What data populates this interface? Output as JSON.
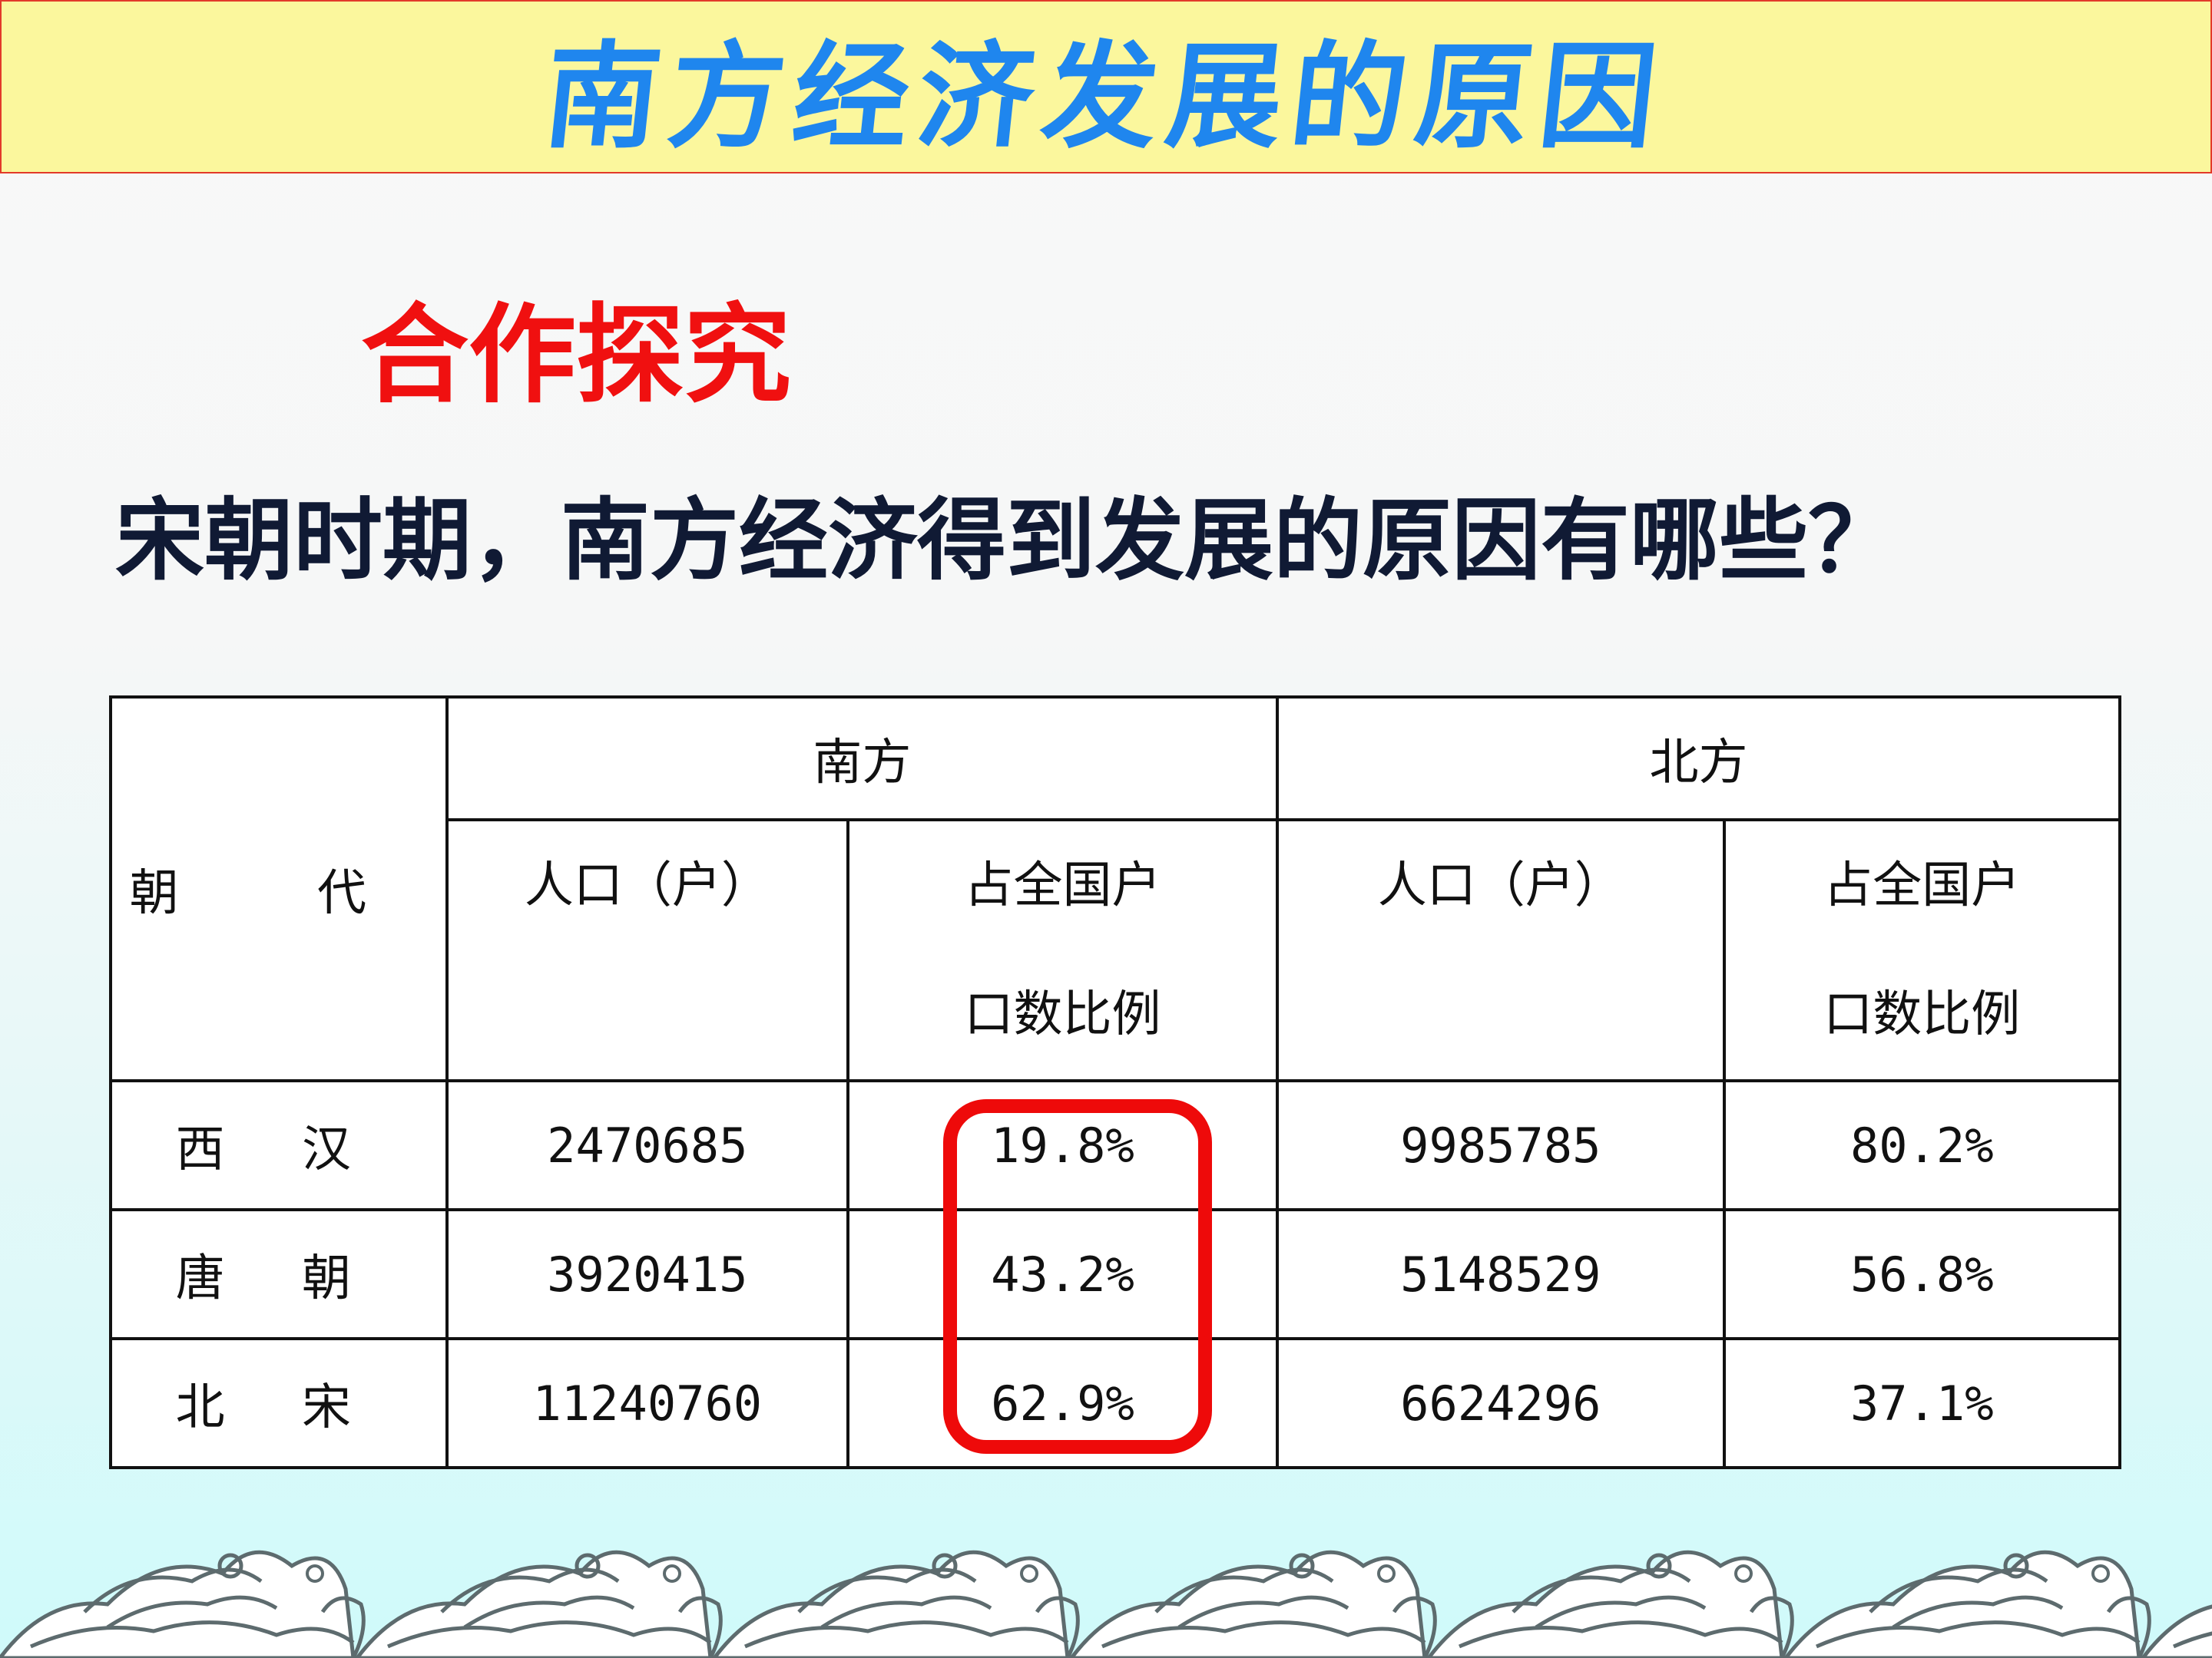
{
  "slide": {
    "title": "南方经济发展的原因",
    "subheading": "合作探究",
    "question": "宋朝时期，南方经济得到发展的原因有哪些？"
  },
  "table": {
    "dynasty_header": "朝 代",
    "south_header": "南方",
    "north_header": "北方",
    "population_label": "人口（户）",
    "ratio_label_line1": "占全国户",
    "ratio_label_line2": "口数比例",
    "rows": [
      {
        "dynasty": "西 汉",
        "south_population": "2470685",
        "south_ratio": "19.8%",
        "north_population": "9985785",
        "north_ratio": "80.2%"
      },
      {
        "dynasty": "唐 朝",
        "south_population": "3920415",
        "south_ratio": "43.2%",
        "north_population": "5148529",
        "north_ratio": "56.8%"
      },
      {
        "dynasty": "北 宋",
        "south_population": "11240760",
        "south_ratio": "62.9%",
        "north_population": "6624296",
        "north_ratio": "37.1%"
      }
    ]
  },
  "colors": {
    "title_text": "#1f86ee",
    "title_background": "#fbf79d",
    "subheading_text": "#f01010",
    "highlight_border": "#ee0a0a"
  },
  "decorations": {
    "highlight": "south-ratio-column-highlight",
    "footer": "ocean-wave-border"
  }
}
